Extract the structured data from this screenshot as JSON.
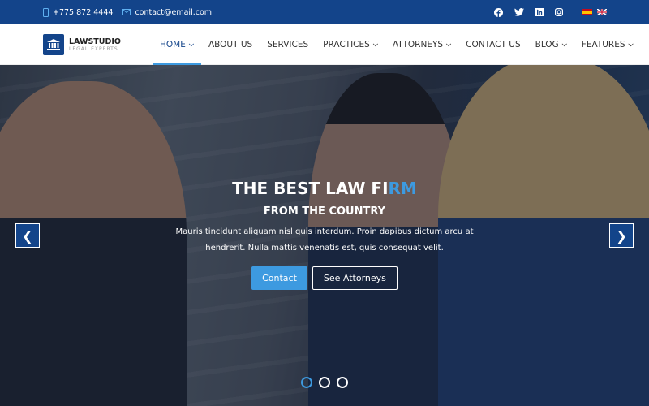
{
  "topbar": {
    "phone": "+775 872 4444",
    "email": "contact@email.com",
    "social": [
      "facebook-icon",
      "twitter-icon",
      "linkedin-icon",
      "instagram-icon"
    ],
    "languages": [
      "es",
      "en"
    ]
  },
  "brand": {
    "name": "LAWSTUDIO",
    "tagline": "LEGAL EXPERTS"
  },
  "menu": [
    {
      "label": "HOME",
      "dropdown": true,
      "active": true
    },
    {
      "label": "ABOUT US"
    },
    {
      "label": "SERVICES"
    },
    {
      "label": "PRACTICES",
      "dropdown": true
    },
    {
      "label": "ATTORNEYS",
      "dropdown": true
    },
    {
      "label": "CONTACT US"
    },
    {
      "label": "BLOG",
      "dropdown": true
    },
    {
      "label": "FEATURES",
      "dropdown": true
    }
  ],
  "hero": {
    "title_main": "THE BEST LAW FI",
    "title_accent": "RM",
    "subtitle": "FROM THE COUNTRY",
    "description_line1": "Mauris tincidunt aliquam nisl quis interdum. Proin dapibus dictum arcu at",
    "description_line2": "hendrerit. Nulla mattis venenatis est, quis consequat velit.",
    "primary_button": "Contact",
    "secondary_button": "See Attorneys",
    "slides": 3,
    "active_slide": 1
  },
  "colors": {
    "primary": "#13448a",
    "accent": "#3d9ae0"
  }
}
